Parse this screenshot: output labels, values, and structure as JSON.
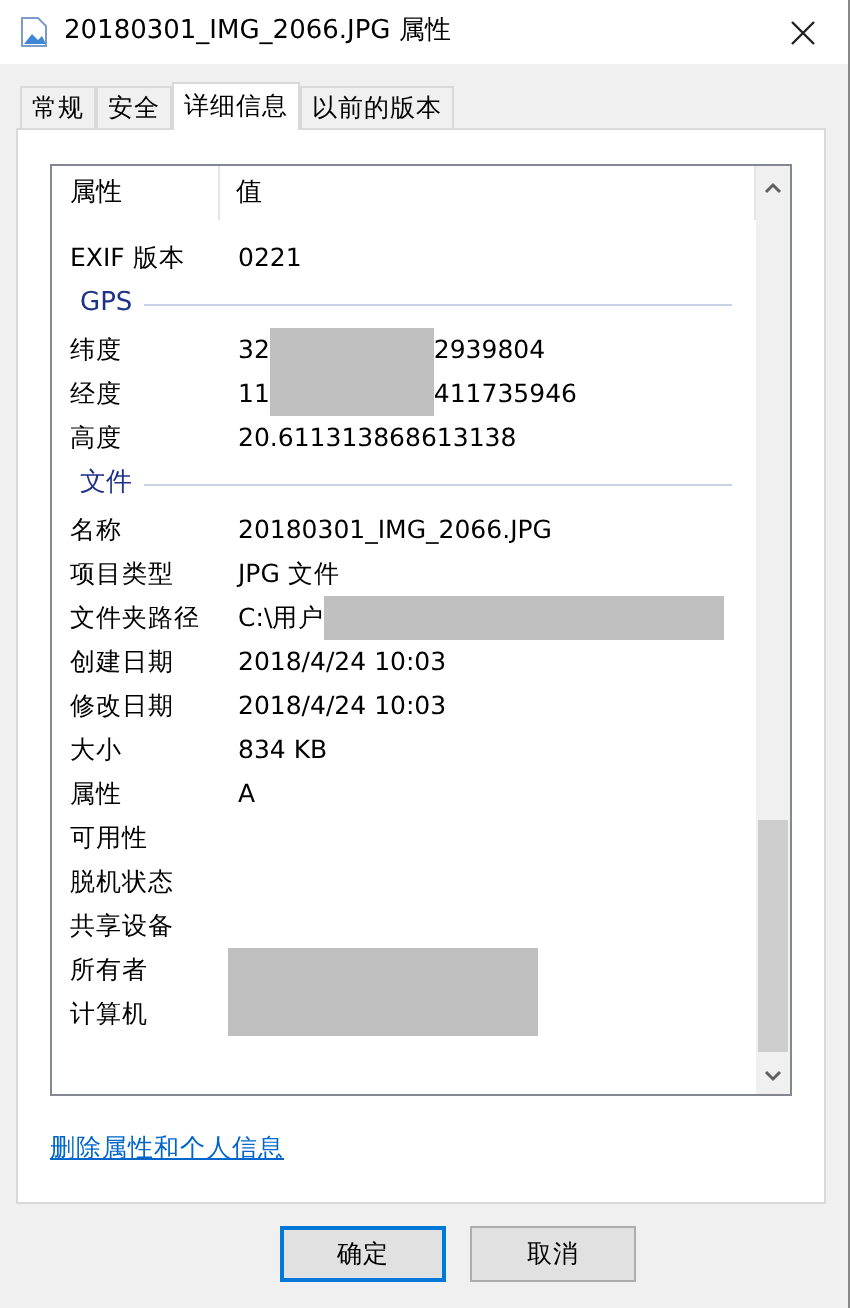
{
  "window": {
    "title": "20180301_IMG_2066.JPG 属性"
  },
  "tabs": [
    {
      "label": "常规",
      "selected": false
    },
    {
      "label": "安全",
      "selected": false
    },
    {
      "label": "详细信息",
      "selected": true
    },
    {
      "label": "以前的版本",
      "selected": false
    }
  ],
  "table": {
    "columns": [
      "属性",
      "值"
    ],
    "rows": [
      {
        "kind": "row",
        "label": "EXIF 版本",
        "value": "0221"
      },
      {
        "kind": "group",
        "label": "GPS"
      },
      {
        "kind": "row",
        "label": "纬度",
        "value": "32",
        "redacted": true,
        "value_end": "2939804"
      },
      {
        "kind": "row",
        "label": "经度",
        "value": "11",
        "redacted": true,
        "value_end": "411735946"
      },
      {
        "kind": "row",
        "label": "高度",
        "value": "20.611313868613138"
      },
      {
        "kind": "group",
        "label": "文件"
      },
      {
        "kind": "row",
        "label": "名称",
        "value": "20180301_IMG_2066.JPG"
      },
      {
        "kind": "row",
        "label": "项目类型",
        "value": "JPG 文件"
      },
      {
        "kind": "row",
        "label": "文件夹路径",
        "value": "C:\\用户",
        "redacted": true
      },
      {
        "kind": "row",
        "label": "创建日期",
        "value": "2018/4/24 10:03"
      },
      {
        "kind": "row",
        "label": "修改日期",
        "value": "2018/4/24 10:03"
      },
      {
        "kind": "row",
        "label": "大小",
        "value": "834 KB"
      },
      {
        "kind": "row",
        "label": "属性",
        "value": "A"
      },
      {
        "kind": "row",
        "label": "可用性"
      },
      {
        "kind": "row",
        "label": "脱机状态"
      },
      {
        "kind": "row",
        "label": "共享设备"
      },
      {
        "kind": "row",
        "label": "所有者",
        "redacted": true
      },
      {
        "kind": "row",
        "label": "计算机",
        "redacted": true
      }
    ]
  },
  "link": "删除属性和个人信息",
  "buttons": [
    {
      "label": "确定",
      "default": true
    },
    {
      "label": "取消",
      "default": false
    }
  ]
}
